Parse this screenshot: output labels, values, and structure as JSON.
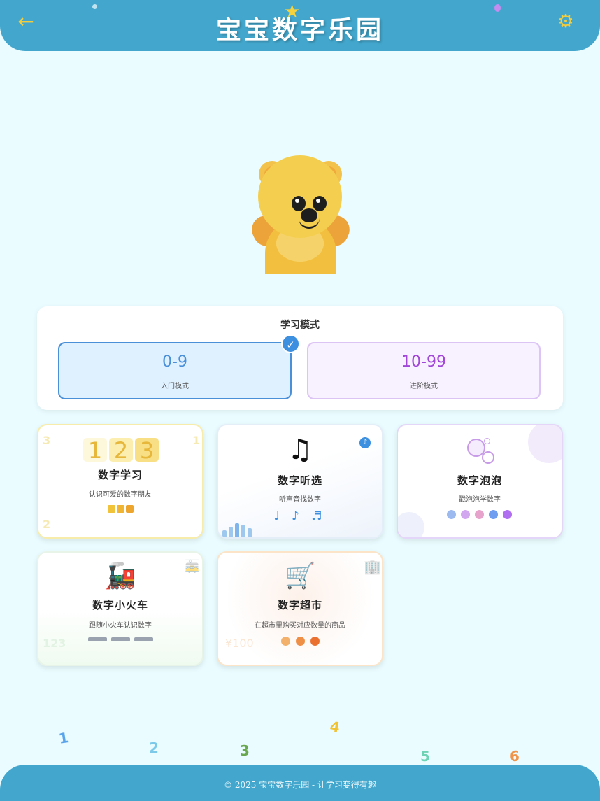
{
  "header": {
    "title": "宝宝数字乐园",
    "back_icon": "arrow-left-icon",
    "settings_icon": "gear-icon"
  },
  "mode_panel": {
    "title": "学习模式",
    "options": [
      {
        "range": "0-9",
        "label": "入门模式",
        "selected": true
      },
      {
        "range": "10-99",
        "label": "进阶模式",
        "selected": false
      }
    ]
  },
  "cards": [
    {
      "title": "数字学习",
      "desc": "认识可爱的数字朋友",
      "tiles": [
        "1",
        "2",
        "3"
      ],
      "corner_nums": [
        "3",
        "1",
        "2"
      ]
    },
    {
      "title": "数字听选",
      "desc": "听声音找数字",
      "icon": "music-note-icon",
      "notes": "♩ ♪ ♬"
    },
    {
      "title": "数字泡泡",
      "desc": "戳泡泡学数字",
      "icon": "bubbles-icon"
    },
    {
      "title": "数字小火车",
      "desc": "跟随小火车认识数字",
      "icon": "train-icon",
      "corner_text": "123"
    },
    {
      "title": "数字超市",
      "desc": "在超市里购买对应数量的商品",
      "icon": "shopping-cart-icon",
      "corner_text": "¥100"
    }
  ],
  "floating_numbers": [
    "1",
    "2",
    "3",
    "4",
    "5",
    "6"
  ],
  "footer": {
    "text": "© 2025 宝宝数字乐园 - 让学习变得有趣"
  },
  "colors": {
    "header_bg": "#43a7cd",
    "accent_yellow": "#f4cd3f",
    "selected_blue": "#4a90d9",
    "advanced_purple": "#a246d9",
    "page_bg": "#eafcff"
  }
}
